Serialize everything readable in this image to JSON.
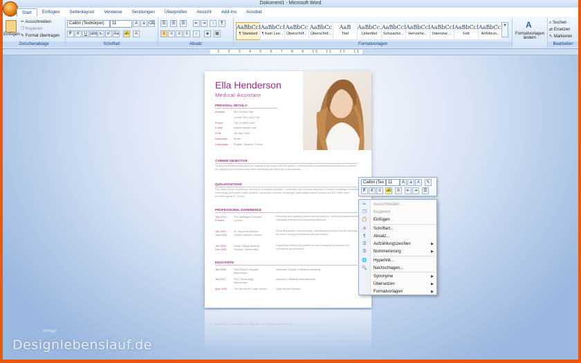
{
  "window": {
    "title": "Dokument1 - Microsoft Word"
  },
  "tabs": [
    "Start",
    "Einfügen",
    "Seitenlayout",
    "Verweise",
    "Sendungen",
    "Überprüfen",
    "Ansicht",
    "Add-Ins",
    "Acrobat"
  ],
  "clipboard": {
    "paste": "Einfügen",
    "cut": "Ausschneiden",
    "copy": "Kopieren",
    "format_painter": "Format übertragen",
    "label": "Zwischenablage"
  },
  "font": {
    "name": "Calibri (Textkörper)",
    "size": "11",
    "label": "Schriftart"
  },
  "paragraph": {
    "label": "Absatz"
  },
  "styles": {
    "label": "Formatvorlagen",
    "items": [
      {
        "preview": "AaBbCcDc",
        "name": "¶ Standard"
      },
      {
        "preview": "AaBbCcDc",
        "name": "¶ Kein Lee..."
      },
      {
        "preview": "AaBbCc",
        "name": "Überschrif..."
      },
      {
        "preview": "AaBbCc",
        "name": "Überschrif..."
      },
      {
        "preview": "AaB",
        "name": "Titel"
      },
      {
        "preview": "AaBbCc.",
        "name": "Untertitel"
      },
      {
        "preview": "AaBbCcDc",
        "name": "Schwache..."
      },
      {
        "preview": "AaBbCcDc",
        "name": "Hervorhe..."
      },
      {
        "preview": "AaBbCcDc",
        "name": "Intensive ..."
      },
      {
        "preview": "AaBbCcDc",
        "name": "Fett"
      },
      {
        "preview": "AaBbCcDc",
        "name": "Anführun..."
      }
    ],
    "change": "Formatvorlagen ändern"
  },
  "editing": {
    "find": "Suchen",
    "replace": "Ersetzen",
    "select": "Markieren",
    "label": "Bearbeiten"
  },
  "resume": {
    "name": "Ella Henderson",
    "role": "Medical Assistant",
    "personal_title": "PERSONAL DETAILS",
    "personal": [
      {
        "k": "Address",
        "v": "804 Sunrise Villa"
      },
      {
        "k": "",
        "v": "London SE4 4QQ, UK"
      },
      {
        "k": "Phone",
        "v": "+44 20 5555 1444"
      },
      {
        "k": "E-Mail",
        "v": "ella@example.com"
      },
      {
        "k": "DOB",
        "v": "4th May 1983"
      },
      {
        "k": "Nationality",
        "v": "British"
      },
      {
        "k": "Languages",
        "v": "English, Spanish, French"
      }
    ],
    "objective_title": "CAREER OBJECTIVE",
    "objective": "To work as a medical assistant and maintain good liaison with the patient. Communication and administrative skills and to deliver the highest level of patient care while maintaining the efficiency of the practice.",
    "qual_title": "QUALIFICATIONS",
    "qual": "More than 5 years experience working as a medical assistant • Certification as a medical assistant • In-depth knowledge of medical terminology and modern office practice • Advanced computer knowledge, particularly medical records and MS Office suite • Excellent typing at 70 wpm",
    "exp_title": "PROFESSIONAL EXPERIENCE",
    "exp": [
      {
        "d1": "July 2011 -",
        "d2": "Present",
        "p1": "The Wellington Hospital",
        "p2": "London",
        "t": "Preparing and updating patient medical histories, scheduling appointments, managing finances and processing payments."
      },
      {
        "d1": "Jan 2009 -",
        "d2": "June 2011",
        "p1": "St. Stephens Mission",
        "p2": "Family Practice, London",
        "t": "Recording patient medical history, vital statistics and test results; assisting the doctor during examinations and procedures."
      },
      {
        "d1": "Jan 2008 -",
        "d2": "Dec 2008",
        "p1": "Urban Village Medical",
        "p2": "Practice, Manchester",
        "t": "Organizing medical and patient records; arranging for lab work and scheduling appointments."
      }
    ],
    "edu_title": "EDUCATION",
    "edu": [
      {
        "d": "Jan 2008",
        "p1": "Saint Mary's Hospital",
        "p2": "Manchester",
        "t": "Associate Degree in Medical Assisting"
      },
      {
        "d": "Jan 2007",
        "p1": "RCC Technology",
        "p2": "Manchester",
        "t": "Diploma in Medical Administration"
      },
      {
        "d": "April 2003",
        "p1": "The Burnes NC High School",
        "p2": "",
        "t": "High School Diploma"
      }
    ]
  },
  "mini_toolbar": {
    "font": "Calibri (Tex",
    "size": "11"
  },
  "context_menu": [
    {
      "label": "Ausschneiden",
      "disabled": true,
      "icon": "✂"
    },
    {
      "label": "Kopieren",
      "disabled": true,
      "icon": "❐"
    },
    {
      "label": "Einfügen",
      "disabled": false,
      "icon": "📋"
    },
    {
      "label": "Schriftart...",
      "disabled": false,
      "icon": "A"
    },
    {
      "label": "Absatz...",
      "disabled": false,
      "icon": "¶"
    },
    {
      "label": "Aufzählungszeichen",
      "disabled": false,
      "icon": "☰",
      "sub": true
    },
    {
      "label": "Nummerierung",
      "disabled": false,
      "icon": "☰",
      "sub": true
    },
    {
      "label": "Hyperlink...",
      "disabled": false,
      "icon": "🌐"
    },
    {
      "label": "Nachschlagen...",
      "disabled": false,
      "icon": "🔍"
    },
    {
      "label": "Synonyme",
      "disabled": false,
      "icon": "",
      "sub": true
    },
    {
      "label": "Übersetzen",
      "disabled": false,
      "icon": "",
      "sub": true
    },
    {
      "label": "Formatvorlagen",
      "disabled": false,
      "icon": "",
      "sub": true
    }
  ],
  "watermark": {
    "main": "Designlebenslauf.de",
    "sub": "vorlage"
  },
  "colors": {
    "accent": "#9b2d86",
    "ribbon": "#d5e4f5",
    "workspace": "#9ab7df",
    "frame": "#e8590e"
  }
}
